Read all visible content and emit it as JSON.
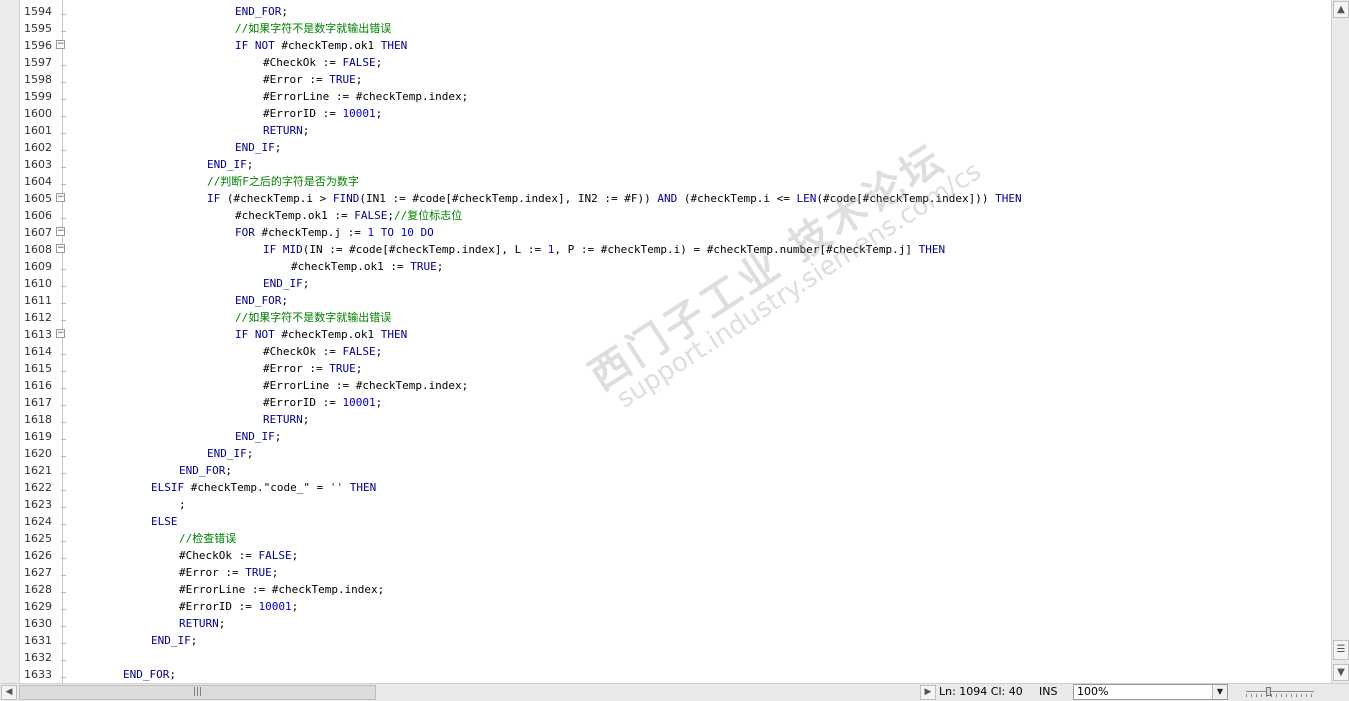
{
  "editor": {
    "lines": [
      {
        "n": "1594",
        "fold": "",
        "indent": 24,
        "tokens": [
          {
            "t": "END_FOR",
            "c": "kw"
          },
          {
            "t": ";"
          }
        ]
      },
      {
        "n": "1595",
        "fold": "",
        "indent": 24,
        "tokens": [
          {
            "t": "//如果字符不是数字就输出错误",
            "c": "cm"
          }
        ]
      },
      {
        "n": "1596",
        "fold": "−",
        "indent": 24,
        "tokens": [
          {
            "t": "IF NOT",
            "c": "kw"
          },
          {
            "t": " #checkTemp.ok1 "
          },
          {
            "t": "THEN",
            "c": "kw"
          }
        ]
      },
      {
        "n": "1597",
        "fold": "",
        "indent": 28,
        "tokens": [
          {
            "t": "#CheckOk := "
          },
          {
            "t": "FALSE",
            "c": "kw"
          },
          {
            "t": ";"
          }
        ]
      },
      {
        "n": "1598",
        "fold": "",
        "indent": 28,
        "tokens": [
          {
            "t": "#Error := "
          },
          {
            "t": "TRUE",
            "c": "kw"
          },
          {
            "t": ";"
          }
        ]
      },
      {
        "n": "1599",
        "fold": "",
        "indent": 28,
        "tokens": [
          {
            "t": "#ErrorLine := #checkTemp.index;"
          }
        ]
      },
      {
        "n": "1600",
        "fold": "",
        "indent": 28,
        "tokens": [
          {
            "t": "#ErrorID := "
          },
          {
            "t": "10001",
            "c": "num"
          },
          {
            "t": ";"
          }
        ]
      },
      {
        "n": "1601",
        "fold": "",
        "indent": 28,
        "tokens": [
          {
            "t": "RETURN",
            "c": "kw"
          },
          {
            "t": ";"
          }
        ]
      },
      {
        "n": "1602",
        "fold": "",
        "indent": 24,
        "tokens": [
          {
            "t": "END_IF",
            "c": "kw"
          },
          {
            "t": ";"
          }
        ]
      },
      {
        "n": "1603",
        "fold": "",
        "indent": 20,
        "tokens": [
          {
            "t": "END_IF",
            "c": "kw"
          },
          {
            "t": ";"
          }
        ]
      },
      {
        "n": "1604",
        "fold": "",
        "indent": 20,
        "tokens": [
          {
            "t": "//判断F之后的字符是否为数字",
            "c": "cm"
          }
        ]
      },
      {
        "n": "1605",
        "fold": "−",
        "indent": 20,
        "tokens": [
          {
            "t": "IF",
            "c": "kw"
          },
          {
            "t": " (#checkTemp.i > "
          },
          {
            "t": "FIND",
            "c": "kw"
          },
          {
            "t": "(IN1 := #code[#checkTemp.index], IN2 := #F)) "
          },
          {
            "t": "AND",
            "c": "kw"
          },
          {
            "t": " (#checkTemp.i <= "
          },
          {
            "t": "LEN",
            "c": "kw"
          },
          {
            "t": "(#code[#checkTemp.index])) "
          },
          {
            "t": "THEN",
            "c": "kw"
          }
        ]
      },
      {
        "n": "1606",
        "fold": "",
        "indent": 24,
        "tokens": [
          {
            "t": "#checkTemp.ok1 := "
          },
          {
            "t": "FALSE",
            "c": "kw"
          },
          {
            "t": ";"
          },
          {
            "t": "//复位标志位",
            "c": "cm"
          }
        ]
      },
      {
        "n": "1607",
        "fold": "−",
        "indent": 24,
        "tokens": [
          {
            "t": "FOR",
            "c": "kw"
          },
          {
            "t": " #checkTemp.j := "
          },
          {
            "t": "1",
            "c": "num"
          },
          {
            "t": " "
          },
          {
            "t": "TO",
            "c": "kw"
          },
          {
            "t": " "
          },
          {
            "t": "10",
            "c": "num"
          },
          {
            "t": " "
          },
          {
            "t": "DO",
            "c": "kw"
          }
        ]
      },
      {
        "n": "1608",
        "fold": "−",
        "indent": 28,
        "tokens": [
          {
            "t": "IF MID",
            "c": "kw"
          },
          {
            "t": "(IN := #code[#checkTemp.index], L := "
          },
          {
            "t": "1",
            "c": "num"
          },
          {
            "t": ", P := #checkTemp.i) = #checkTemp.number[#checkTemp.j] "
          },
          {
            "t": "THEN",
            "c": "kw"
          }
        ]
      },
      {
        "n": "1609",
        "fold": "",
        "indent": 32,
        "tokens": [
          {
            "t": "#checkTemp.ok1 := "
          },
          {
            "t": "TRUE",
            "c": "kw"
          },
          {
            "t": ";"
          }
        ]
      },
      {
        "n": "1610",
        "fold": "",
        "indent": 28,
        "tokens": [
          {
            "t": "END_IF",
            "c": "kw"
          },
          {
            "t": ";"
          }
        ]
      },
      {
        "n": "1611",
        "fold": "",
        "indent": 24,
        "tokens": [
          {
            "t": "END_FOR",
            "c": "kw"
          },
          {
            "t": ";"
          }
        ]
      },
      {
        "n": "1612",
        "fold": "",
        "indent": 24,
        "tokens": [
          {
            "t": "//如果字符不是数字就输出错误",
            "c": "cm"
          }
        ]
      },
      {
        "n": "1613",
        "fold": "−",
        "indent": 24,
        "tokens": [
          {
            "t": "IF NOT",
            "c": "kw"
          },
          {
            "t": " #checkTemp.ok1 "
          },
          {
            "t": "THEN",
            "c": "kw"
          }
        ]
      },
      {
        "n": "1614",
        "fold": "",
        "indent": 28,
        "tokens": [
          {
            "t": "#CheckOk := "
          },
          {
            "t": "FALSE",
            "c": "kw"
          },
          {
            "t": ";"
          }
        ]
      },
      {
        "n": "1615",
        "fold": "",
        "indent": 28,
        "tokens": [
          {
            "t": "#Error := "
          },
          {
            "t": "TRUE",
            "c": "kw"
          },
          {
            "t": ";"
          }
        ]
      },
      {
        "n": "1616",
        "fold": "",
        "indent": 28,
        "tokens": [
          {
            "t": "#ErrorLine := #checkTemp.index;"
          }
        ]
      },
      {
        "n": "1617",
        "fold": "",
        "indent": 28,
        "tokens": [
          {
            "t": "#ErrorID := "
          },
          {
            "t": "10001",
            "c": "num"
          },
          {
            "t": ";"
          }
        ]
      },
      {
        "n": "1618",
        "fold": "",
        "indent": 28,
        "tokens": [
          {
            "t": "RETURN",
            "c": "kw"
          },
          {
            "t": ";"
          }
        ]
      },
      {
        "n": "1619",
        "fold": "",
        "indent": 24,
        "tokens": [
          {
            "t": "END_IF",
            "c": "kw"
          },
          {
            "t": ";"
          }
        ]
      },
      {
        "n": "1620",
        "fold": "",
        "indent": 20,
        "tokens": [
          {
            "t": "END_IF",
            "c": "kw"
          },
          {
            "t": ";"
          }
        ]
      },
      {
        "n": "1621",
        "fold": "",
        "indent": 16,
        "tokens": [
          {
            "t": "END_FOR",
            "c": "kw"
          },
          {
            "t": ";"
          }
        ]
      },
      {
        "n": "1622",
        "fold": "",
        "indent": 12,
        "tokens": [
          {
            "t": "ELSIF",
            "c": "kw"
          },
          {
            "t": " #checkTemp.\"code_\" = "
          },
          {
            "t": "''",
            "c": "str"
          },
          {
            "t": " "
          },
          {
            "t": "THEN",
            "c": "kw"
          }
        ]
      },
      {
        "n": "1623",
        "fold": "",
        "indent": 16,
        "tokens": [
          {
            "t": ";"
          }
        ]
      },
      {
        "n": "1624",
        "fold": "",
        "indent": 12,
        "tokens": [
          {
            "t": "ELSE",
            "c": "kw"
          }
        ]
      },
      {
        "n": "1625",
        "fold": "",
        "indent": 16,
        "tokens": [
          {
            "t": "//检查错误",
            "c": "cm"
          }
        ]
      },
      {
        "n": "1626",
        "fold": "",
        "indent": 16,
        "tokens": [
          {
            "t": "#CheckOk := "
          },
          {
            "t": "FALSE",
            "c": "kw"
          },
          {
            "t": ";"
          }
        ]
      },
      {
        "n": "1627",
        "fold": "",
        "indent": 16,
        "tokens": [
          {
            "t": "#Error := "
          },
          {
            "t": "TRUE",
            "c": "kw"
          },
          {
            "t": ";"
          }
        ]
      },
      {
        "n": "1628",
        "fold": "",
        "indent": 16,
        "tokens": [
          {
            "t": "#ErrorLine := #checkTemp.index;"
          }
        ]
      },
      {
        "n": "1629",
        "fold": "",
        "indent": 16,
        "tokens": [
          {
            "t": "#ErrorID := "
          },
          {
            "t": "10001",
            "c": "num"
          },
          {
            "t": ";"
          }
        ]
      },
      {
        "n": "1630",
        "fold": "",
        "indent": 16,
        "tokens": [
          {
            "t": "RETURN",
            "c": "kw"
          },
          {
            "t": ";"
          }
        ]
      },
      {
        "n": "1631",
        "fold": "",
        "indent": 12,
        "tokens": [
          {
            "t": "END_IF",
            "c": "kw"
          },
          {
            "t": ";"
          }
        ]
      },
      {
        "n": "1632",
        "fold": "",
        "indent": 0,
        "tokens": []
      },
      {
        "n": "1633",
        "fold": "",
        "indent": 8,
        "tokens": [
          {
            "t": "END_FOR",
            "c": "kw"
          },
          {
            "t": ";"
          }
        ]
      }
    ]
  },
  "scrollbar": {
    "up_icon": "▲",
    "down_icon": "▼",
    "split_icon": "☰",
    "left_icon": "◀",
    "right_icon": "▶",
    "thumb_grip": "|||"
  },
  "status": {
    "ln_col": "Ln: 1094  Cl: 40",
    "ins": "INS",
    "zoom": "100%",
    "zoom_dropdown_icon": "▼"
  },
  "watermark": {
    "cn": "西门子工业 技术论坛",
    "url": "support.industry.siemens.com/cs"
  },
  "colors": {
    "keyword": "#00008b",
    "comment": "#008000",
    "number": "#0000cd",
    "string": "#a31515"
  }
}
